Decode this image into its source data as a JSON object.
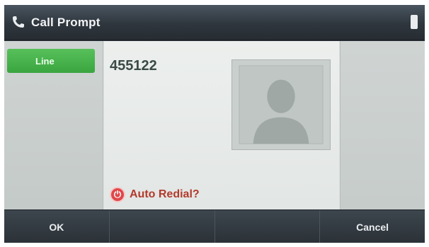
{
  "window": {
    "title": "Call Prompt"
  },
  "line": {
    "label": "Line"
  },
  "call": {
    "number": "455122",
    "auto_redial_label": "Auto Redial?"
  },
  "softkeys": [
    {
      "label": "OK"
    },
    {
      "label": ""
    },
    {
      "label": ""
    },
    {
      "label": "Cancel"
    }
  ],
  "icons": {
    "title": "phone-icon",
    "status": "battery-icon",
    "redial": "power-icon",
    "avatar": "person-silhouette-icon"
  },
  "colors": {
    "line_tab": "#3aa53f",
    "redial": "#e0474a",
    "title_bar": "#2f363d"
  }
}
